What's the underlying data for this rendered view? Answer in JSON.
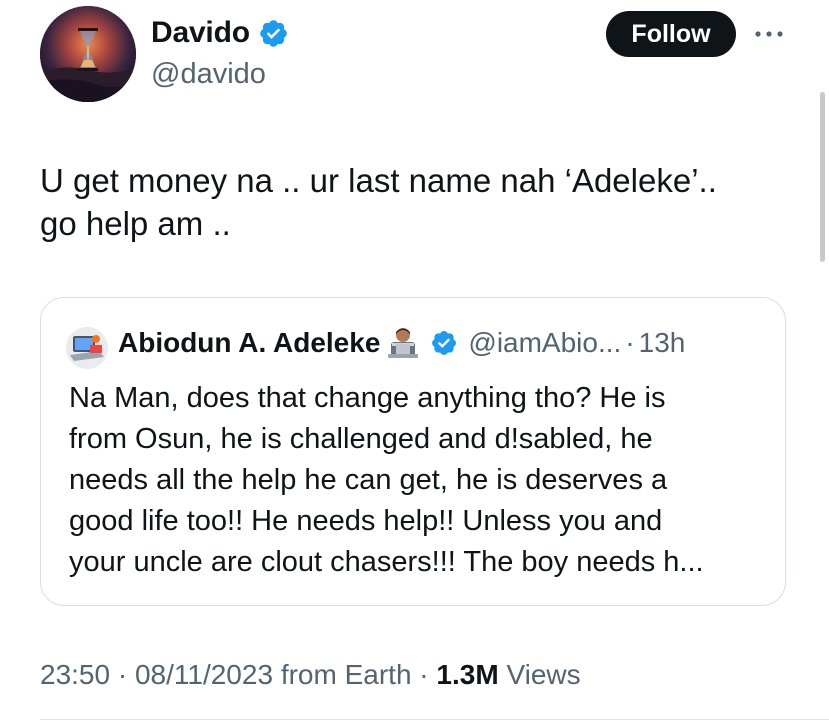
{
  "author": {
    "display_name": "Davido",
    "handle": "@davido",
    "verified": true,
    "follow_label": "Follow"
  },
  "tweet": {
    "text_line1": "U get money na .. ur last name nah ‘Adeleke’..",
    "text_line2": "go help am .."
  },
  "quote": {
    "display_name": "Abiodun A. Adeleke",
    "emoji": "technologist-emoji",
    "verified": true,
    "handle": "@iamAbio...",
    "separator": "·",
    "time": "13h",
    "lines": [
      "Na Man, does that change anything tho? He is",
      "from Osun, he is challenged and d!sabled, he",
      "needs all the help he can get, he is deserves a",
      "good life too!! He needs help!! Unless you and",
      "your uncle are clout chasers!!! The boy needs h..."
    ]
  },
  "meta": {
    "time": "23:50",
    "separator": "·",
    "date": "08/11/2023",
    "source": "from Earth",
    "views_count": "1.3M",
    "views_label": "Views"
  },
  "colors": {
    "verified_blue": "#1d9bf0",
    "text_primary": "#0f1419",
    "text_secondary": "#536471",
    "border": "#d9dee2"
  }
}
